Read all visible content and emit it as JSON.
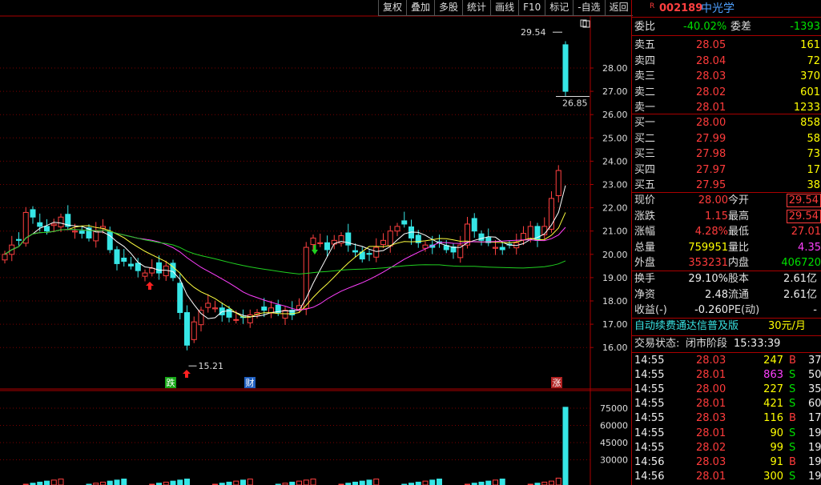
{
  "toolbar": {
    "items": [
      "复权",
      "叠加",
      "多股",
      "统计",
      "画线",
      "F10",
      "标记",
      "-自选",
      "返回"
    ]
  },
  "chart_data": {
    "type": "candlestick",
    "price_axis": {
      "ticks": [
        "28.00",
        "27.00",
        "26.00",
        "25.00",
        "24.00",
        "23.00",
        "22.00",
        "21.00",
        "20.00",
        "19.00",
        "18.00",
        "17.00",
        "16.00"
      ]
    },
    "annotations": {
      "high": "29.54",
      "low": "15.21",
      "prev_close_marker": "26.85"
    },
    "volume_axis": {
      "ticks": [
        "75000",
        "60000",
        "45000",
        "30000"
      ]
    },
    "event_labels": [
      "跌",
      "财",
      "涨"
    ]
  },
  "panel": {
    "r_icon": "R",
    "code": "002189",
    "name": "中光学",
    "weibi": {
      "label": "委比",
      "value": "-40.02%",
      "label2": "委差",
      "value2": "-1393"
    },
    "sell": [
      {
        "label": "卖五",
        "price": "28.05",
        "vol": "161"
      },
      {
        "label": "卖四",
        "price": "28.04",
        "vol": "72"
      },
      {
        "label": "卖三",
        "price": "28.03",
        "vol": "370"
      },
      {
        "label": "卖二",
        "price": "28.02",
        "vol": "601"
      },
      {
        "label": "卖一",
        "price": "28.01",
        "vol": "1233"
      }
    ],
    "buy": [
      {
        "label": "买一",
        "price": "28.00",
        "vol": "858"
      },
      {
        "label": "买二",
        "price": "27.99",
        "vol": "58"
      },
      {
        "label": "买三",
        "price": "27.98",
        "vol": "73"
      },
      {
        "label": "买四",
        "price": "27.97",
        "vol": "17"
      },
      {
        "label": "买五",
        "price": "27.95",
        "vol": "38"
      }
    ],
    "stats": [
      {
        "l1": "现价",
        "v1": "28.00",
        "c1": "red",
        "l2": "今开",
        "v2": "29.54",
        "c2": "red",
        "box": true
      },
      {
        "l1": "涨跌",
        "v1": "1.15",
        "c1": "red",
        "l2": "最高",
        "v2": "29.54",
        "c2": "red",
        "box": true
      },
      {
        "l1": "涨幅",
        "v1": "4.28%",
        "c1": "red",
        "l2": "最低",
        "v2": "27.01",
        "c2": "red",
        "box": false
      },
      {
        "l1": "总量",
        "v1": "759951",
        "c1": "yellow",
        "l2": "量比",
        "v2": "4.35",
        "c2": "magenta",
        "box": false
      },
      {
        "l1": "外盘",
        "v1": "353231",
        "c1": "red",
        "l2": "内盘",
        "v2": "406720",
        "c2": "green",
        "box": false
      }
    ],
    "stats2": [
      {
        "l1": "换手",
        "v1": "29.10%",
        "l2": "股本",
        "v2": "2.61亿"
      },
      {
        "l1": "净资",
        "v1": "2.48",
        "l2": "流通",
        "v2": "2.61亿"
      },
      {
        "l1": "收益(-)",
        "v1": "-0.260",
        "l2": "PE(动)",
        "v2": "-"
      }
    ],
    "ad": {
      "text": "自动续费通达信普及版",
      "price": "30元/月"
    },
    "status": {
      "label": "交易状态:",
      "value": "闭市阶段",
      "time": "15:33:39"
    },
    "ticks": [
      {
        "time": "14:55",
        "price": "28.03",
        "vol": "247",
        "side": "B",
        "n": "37",
        "vc": "yellow"
      },
      {
        "time": "14:55",
        "price": "28.01",
        "vol": "863",
        "side": "S",
        "n": "50",
        "vc": "magenta"
      },
      {
        "time": "14:55",
        "price": "28.00",
        "vol": "227",
        "side": "S",
        "n": "35",
        "vc": "yellow"
      },
      {
        "time": "14:55",
        "price": "28.01",
        "vol": "421",
        "side": "S",
        "n": "60",
        "vc": "yellow"
      },
      {
        "time": "14:55",
        "price": "28.03",
        "vol": "116",
        "side": "B",
        "n": "17",
        "vc": "yellow"
      },
      {
        "time": "14:55",
        "price": "28.01",
        "vol": "90",
        "side": "S",
        "n": "19",
        "vc": "yellow"
      },
      {
        "time": "14:55",
        "price": "28.02",
        "vol": "99",
        "side": "S",
        "n": "19",
        "vc": "yellow"
      },
      {
        "time": "14:56",
        "price": "28.03",
        "vol": "91",
        "side": "B",
        "n": "19",
        "vc": "yellow"
      },
      {
        "time": "14:56",
        "price": "28.01",
        "vol": "300",
        "side": "S",
        "n": "19",
        "vc": "yellow"
      }
    ]
  }
}
